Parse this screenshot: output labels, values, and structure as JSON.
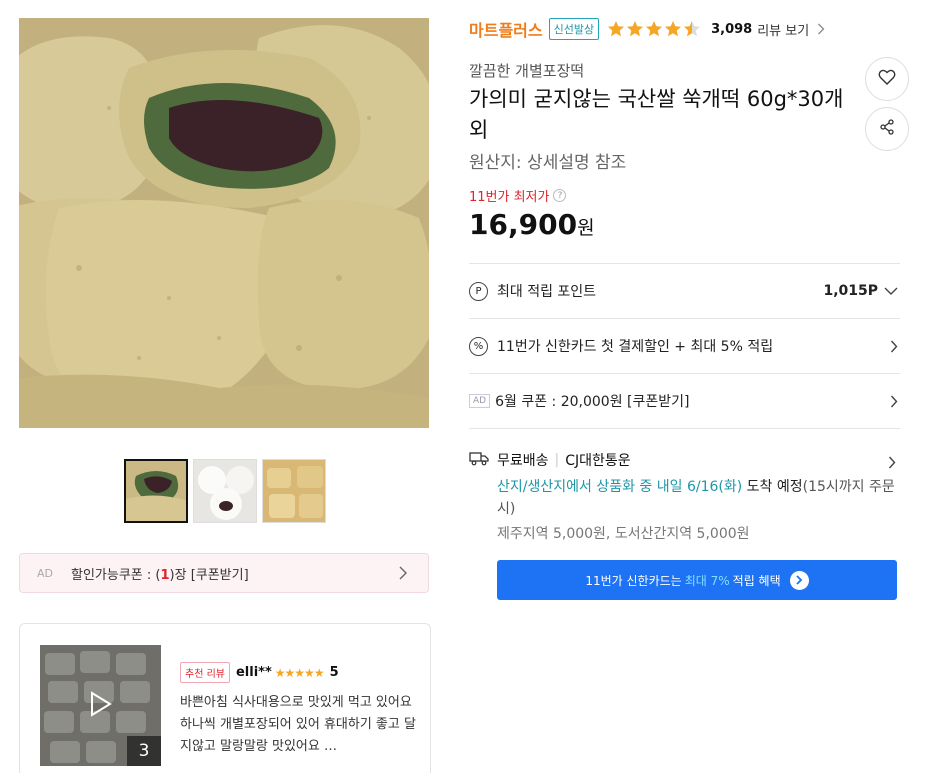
{
  "product": {
    "brand": "마트플러스",
    "delivery_tag": "신선발상",
    "rating_stars": 4.5,
    "review_count": "3,098",
    "review_link": "리뷰 보기",
    "subtitle": "깔끔한 개별포장떡",
    "title": "가의미 굳지않는 국산쌀 쑥개떡 60g*30개 외",
    "origin": "원산지: 상세설명 참조",
    "lowest_label": "11번가 최저가",
    "price": "16,900",
    "price_unit": "원"
  },
  "thumbnails": [
    "thumb-1",
    "thumb-2",
    "thumb-3"
  ],
  "coupon_bar": {
    "ad": "AD",
    "prefix": "할인가능쿠폰 : (",
    "count": "1",
    "suffix": ")장 [쿠폰받기]"
  },
  "review": {
    "badge": "추천 리뷰",
    "user": "elli**",
    "stars": "★★★★★",
    "score": "5",
    "text": "바쁜아침 식사대용으로 맛있게 먹고 있어요 하나씩 개별포장되어 있어 휴대하기 좋고 달지않고 말랑말랑 맛있어요 …",
    "image_count": "3"
  },
  "points": {
    "label": "최대 적립 포인트",
    "value": "1,015P"
  },
  "card_offer": {
    "label": "11번가 신한카드 첫 결제할인 + 최대 5% 적립"
  },
  "ad_coupon": {
    "ad": "AD",
    "label": "6월 쿠폰 : 20,000원 [쿠폰받기]"
  },
  "shipping": {
    "free": "무료배송",
    "carrier": "CJ대한통운",
    "arrival_hl": "산지/생산지에서 상품화 중 내일 6/16(화)",
    "arrival_rest": " 도착 예정",
    "arrival_note": "(15시까지 주문 시)",
    "extra_fee": "제주지역 5,000원, 도서산간지역 5,000원"
  },
  "banner": {
    "prefix": "11번가 신한카드는",
    "highlight": "최대 7%",
    "suffix": "적립 혜택"
  },
  "colors": {
    "brand": "#f07d1b",
    "accent_red": "#e0222b",
    "teal": "#1d97a8",
    "blue_banner": "#1e73f5",
    "star": "#f5a623"
  }
}
